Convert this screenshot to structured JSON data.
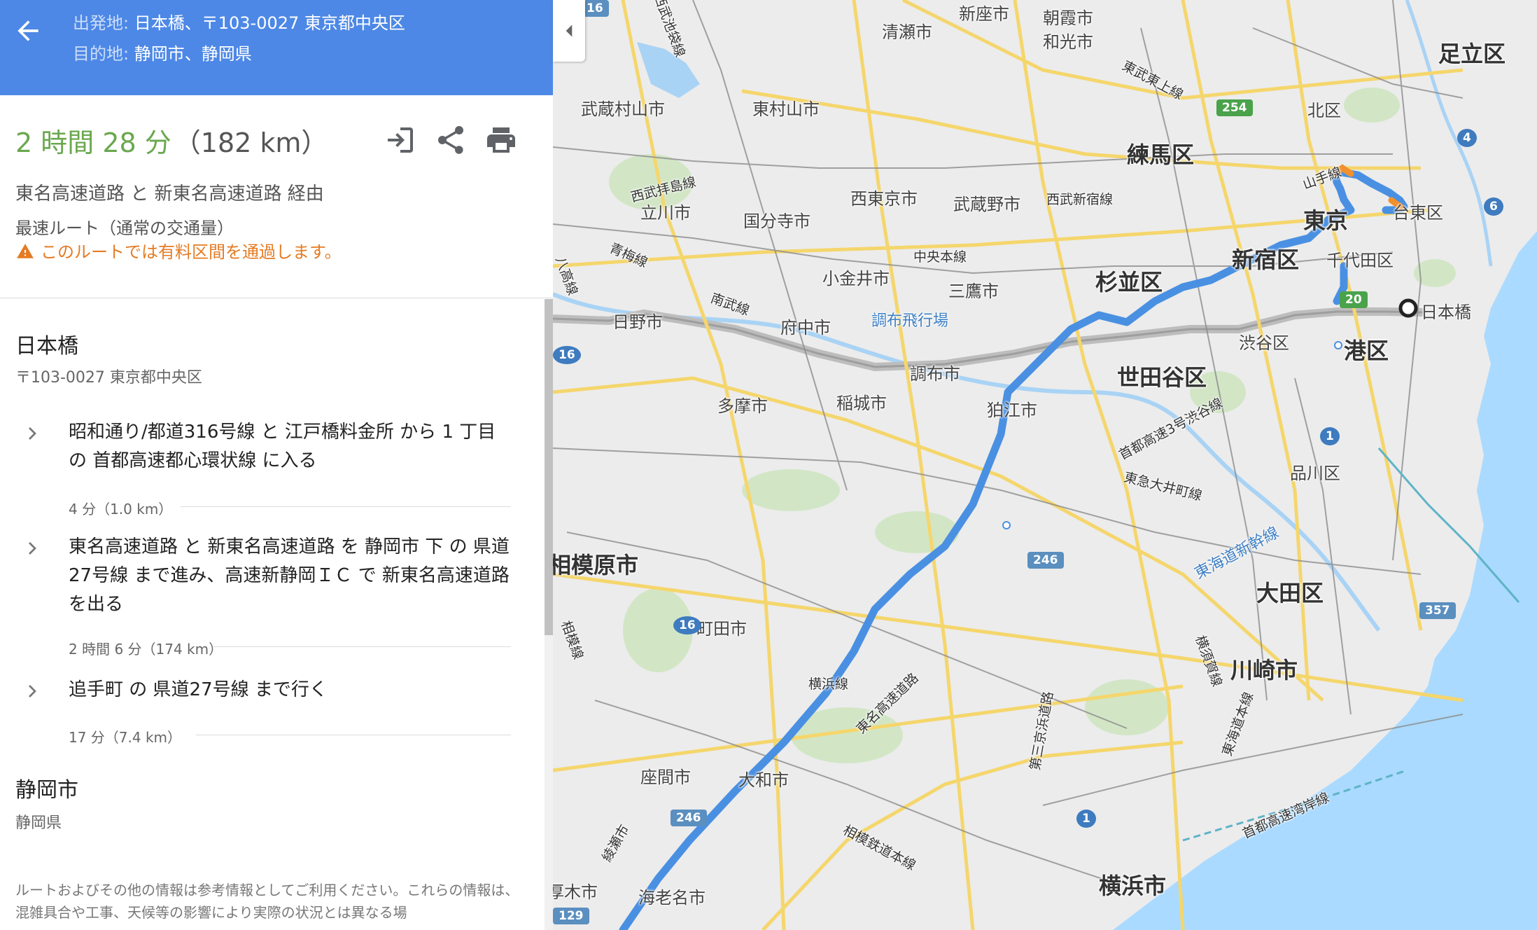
{
  "header": {
    "back_label": "back-arrow",
    "origin_label": "出発地:",
    "origin_value": "日本橋、〒103-0027 東京都中央区",
    "dest_label": "目的地:",
    "dest_value": "静岡市、静岡県"
  },
  "summary": {
    "duration": "2 時間 28 分",
    "distance": "（182 km）",
    "via": "東名高速道路 と 新東名高速道路 経由",
    "fastest": "最速ルート（通常の交通量）",
    "toll_warning": "このルートでは有料区間を通過します。",
    "icons": [
      "send-to-device-icon",
      "share-icon",
      "print-icon"
    ]
  },
  "directions": {
    "origin_name": "日本橋",
    "origin_address": "〒103-0027 東京都中央区",
    "steps": [
      {
        "text": "昭和通り/都道316号線 と 江戸橋料金所 から 1 丁目 の 首都高速都心環状線 に入る",
        "meta": "4 分（1.0 km）"
      },
      {
        "text": "東名高速道路 と 新東名高速道路 を 静岡市 下 の 県道27号線 まで進み、高速新静岡ＩＣ で 新東名高速道路 を出る",
        "meta": "2 時間 6 分（174 km）"
      },
      {
        "text": "追手町 の 県道27号線 まで行く",
        "meta": "17 分（7.4 km）"
      }
    ],
    "dest_name": "静岡市",
    "dest_region": "静岡県",
    "disclaimer": "ルートおよびその他の情報は参考情報としてご利用ください。これらの情報は、混雑具合や工事、天候等の影響により実際の状況とは異なる場"
  },
  "map": {
    "labels": {
      "seishin_ike": "西武池袋線",
      "kiyose": "清瀬市",
      "niiza": "新座市",
      "asaka": "朝霞市",
      "wako": "和光市",
      "adachi": "足立区",
      "tobu_tojo": "東武東上線",
      "musashimurayama": "武蔵村山市",
      "higashimurayama": "東村山市",
      "kita": "北区",
      "nerima": "練馬区",
      "seibu_haijima": "西武拝島線",
      "tachikawa": "立川市",
      "nishitokyo": "西東京市",
      "musashino": "武蔵野市",
      "seibu_shinjuku": "西武新宿線",
      "yamanote": "山手線",
      "kokubunji": "国分寺市",
      "tokyo": "東京",
      "taito": "台東区",
      "ome": "青梅線",
      "hachiko": "八高線",
      "chuo_honsen": "中央本線",
      "koganei": "小金井市",
      "suginami": "杉並区",
      "shinjuku": "新宿区",
      "chiyoda": "千代田区",
      "mitaka": "三鷹市",
      "nambu": "南武線",
      "hino": "日野市",
      "fuchu": "府中市",
      "chofu_airport": "調布飛行場",
      "nihonbashi": "日本橋",
      "shibuya": "渋谷区",
      "minato": "港区",
      "chofu": "調布市",
      "setagaya": "世田谷区",
      "tama": "多摩市",
      "inagi": "稲城市",
      "komae": "狛江市",
      "shuto3": "首都高速3号渋谷線",
      "shinagawa": "品川区",
      "tokyu_oimachi": "東急大井町線",
      "sagamihara": "相模原市",
      "tokaido_shinkansen": "東海道新幹線",
      "ota": "大田区",
      "machida": "町田市",
      "sagami": "相模線",
      "yokohama_line": "横浜線",
      "kawasaki": "川崎市",
      "yokosuka": "横須賀線",
      "tomei": "東名高速道路",
      "daisan_keihin": "第三京浜道路",
      "tokaido_honsen": "東海道本線",
      "zama": "座間市",
      "yamato": "大和市",
      "shuto_wangan": "首都高速湾岸線",
      "sotetsu": "相模鉄道本線",
      "yokohama": "横浜市",
      "atsugi": "厚木市",
      "ebina": "海老名市",
      "ayase": "綾瀬市"
    },
    "shields": [
      "16",
      "254",
      "4",
      "6",
      "20",
      "16",
      "1",
      "246",
      "357",
      "16",
      "246",
      "1",
      "129"
    ]
  },
  "colors": {
    "header_bg": "#4d88e6",
    "duration_green": "#6aa84f",
    "toll_orange": "#e57b23",
    "route_blue": "#4a90e2"
  }
}
